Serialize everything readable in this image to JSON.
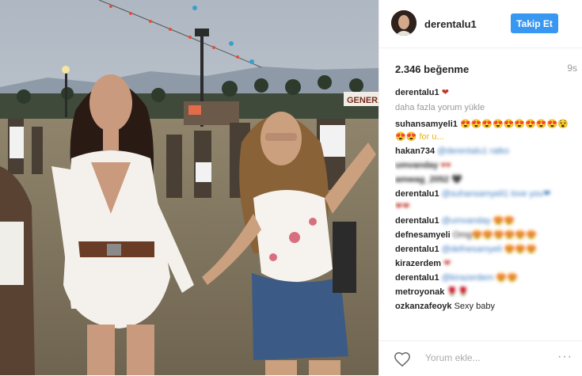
{
  "header": {
    "username": "derentalu1",
    "follow_label": "Takip Et"
  },
  "stats": {
    "likes": "2.346 beğenme",
    "time_ago": "9s"
  },
  "caption": {
    "username": "derentalu1",
    "text": "❤"
  },
  "load_more": "daha fazla yorum yükle",
  "comments": [
    {
      "username": "suhansamyeli1",
      "text": "😍😍😍😍😍😍😍😍😍😵"
    },
    {
      "username": "",
      "text": "😍😍 for u..."
    },
    {
      "username": "hakan734",
      "text": "@derentalu1 ratko"
    },
    {
      "username": "umvanday",
      "text": "♥♥"
    },
    {
      "username": "amwag_2052",
      "text": "🖤"
    },
    {
      "username": "derentalu1",
      "text": "@suhansamyeli1 love you❤"
    },
    {
      "username": "",
      "text": "❤❤"
    },
    {
      "username": "derentalu1",
      "text": "@umvanday 😍😍"
    },
    {
      "username": "defnesamyeli",
      "text": "Omg😍😍😍😍😍😍"
    },
    {
      "username": "derentalu1",
      "text": "@defnesamyeli 😍😍😍"
    },
    {
      "username": "kirazerdem",
      "text": "❤"
    },
    {
      "username": "derentalu1",
      "text": "@kirazerdem 😍😍"
    },
    {
      "username": "metroyonak",
      "text": "🌹🌹"
    },
    {
      "username": "ozkanzafeoyk",
      "text": "Sexy baby"
    }
  ],
  "footer": {
    "comment_placeholder": "Yorum ekle...",
    "more_label": "···"
  },
  "photo": {
    "sign_text": "GENERA"
  },
  "colors": {
    "accent": "#3897f0",
    "text": "#262626",
    "muted": "#999999",
    "mention": "#3d7cc0"
  }
}
